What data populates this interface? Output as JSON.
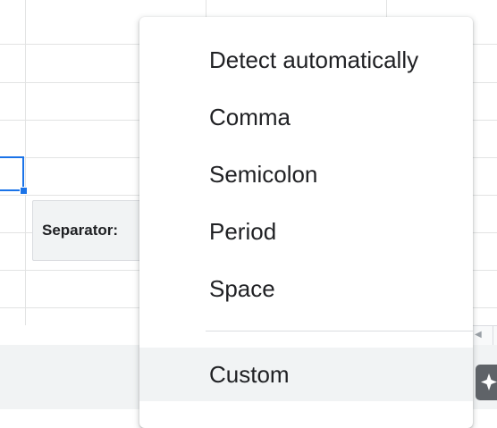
{
  "separator": {
    "label": "Separator:"
  },
  "menu": {
    "items": [
      {
        "label": "Detect automatically"
      },
      {
        "label": "Comma"
      },
      {
        "label": "Semicolon"
      },
      {
        "label": "Period"
      },
      {
        "label": "Space"
      }
    ],
    "custom": {
      "label": "Custom"
    }
  },
  "icons": {
    "explore": "explore-sparkle-icon",
    "scroll_left": "scroll-left-arrow-icon"
  },
  "colors": {
    "selection": "#1a73e8",
    "menu_text": "#202124",
    "hover": "#f1f3f4",
    "gridline": "#e2e3e3"
  }
}
